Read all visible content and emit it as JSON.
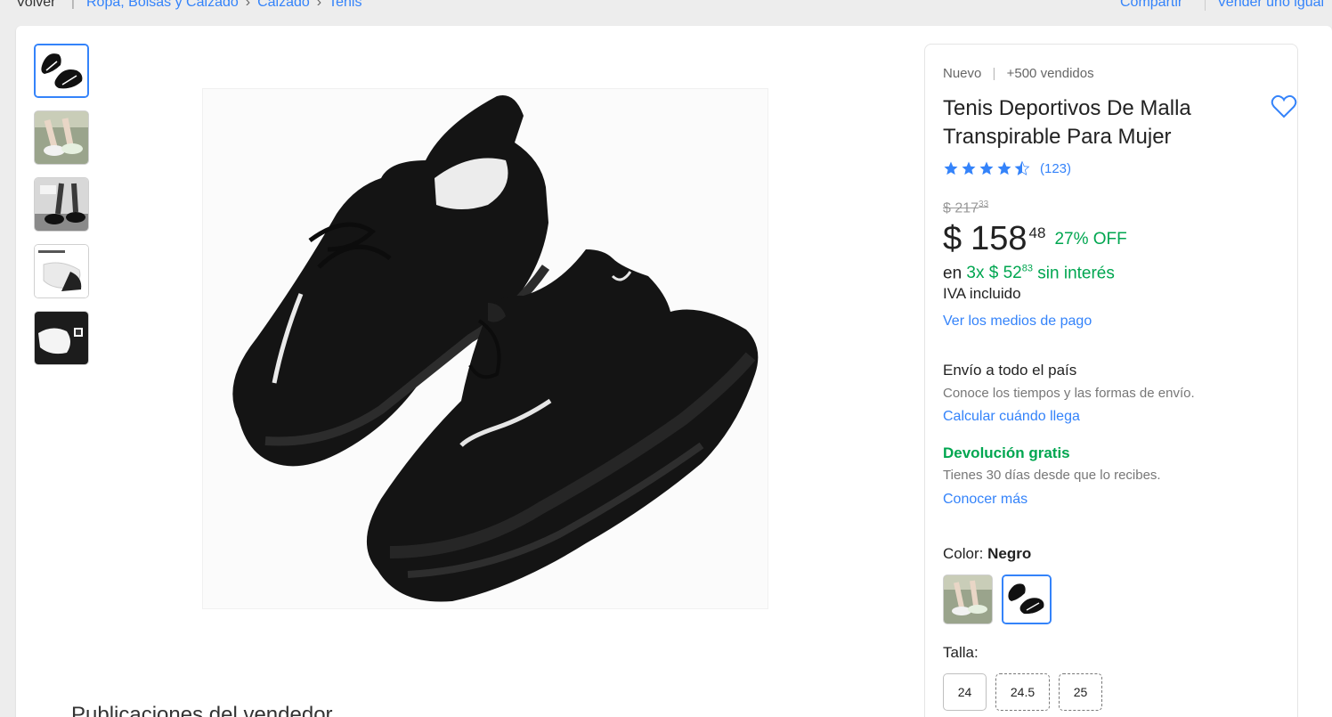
{
  "topbar": {
    "back_label": "Volver",
    "separator": "|",
    "breadcrumbs": [
      "Ropa, Bolsas y Calzado",
      "Calzado",
      "Tenis"
    ],
    "share_label": "Compartir",
    "sell_label": "Vender uno igual"
  },
  "gallery": {
    "thumbnails": [
      "shoe-black-pair",
      "shoe-worn-light",
      "shoe-worn-black",
      "shoe-insole",
      "shoe-white-pair"
    ],
    "main_image": "black-mesh-sneakers-pair"
  },
  "seller_section": {
    "title": "Publicaciones del vendedor"
  },
  "product": {
    "condition": "Nuevo",
    "sold": "+500 vendidos",
    "title": "Tenis Deportivos De Malla Transpirable Para Mujer",
    "rating": 4.5,
    "reviews": "(123)",
    "original_price_int": "$ 217",
    "original_price_cents": "33",
    "currency": "$",
    "price_int": "158",
    "price_cents": "48",
    "discount": "27% OFF",
    "installments_prefix": "en",
    "installments_amount": "3x $ 52",
    "installments_cents": "83",
    "installments_suffix": "sin interés",
    "iva": "IVA incluido",
    "payment_link": "Ver los medios de pago"
  },
  "shipping": {
    "title": "Envío a todo el país",
    "subtitle": "Conoce los tiempos y las formas de envío.",
    "link": "Calcular cuándo llega"
  },
  "returns": {
    "title": "Devolución gratis",
    "subtitle": "Tienes 30 días desde que lo recibes.",
    "link": "Conocer más"
  },
  "variants": {
    "color_label": "Color:",
    "color_value": "Negro",
    "colors": [
      "white-variant",
      "black-variant"
    ],
    "size_label": "Talla:",
    "sizes": [
      "24",
      "24.5",
      "25"
    ]
  },
  "colors": {
    "link": "#3483fa",
    "green": "#00a650",
    "star": "#3483fa"
  }
}
